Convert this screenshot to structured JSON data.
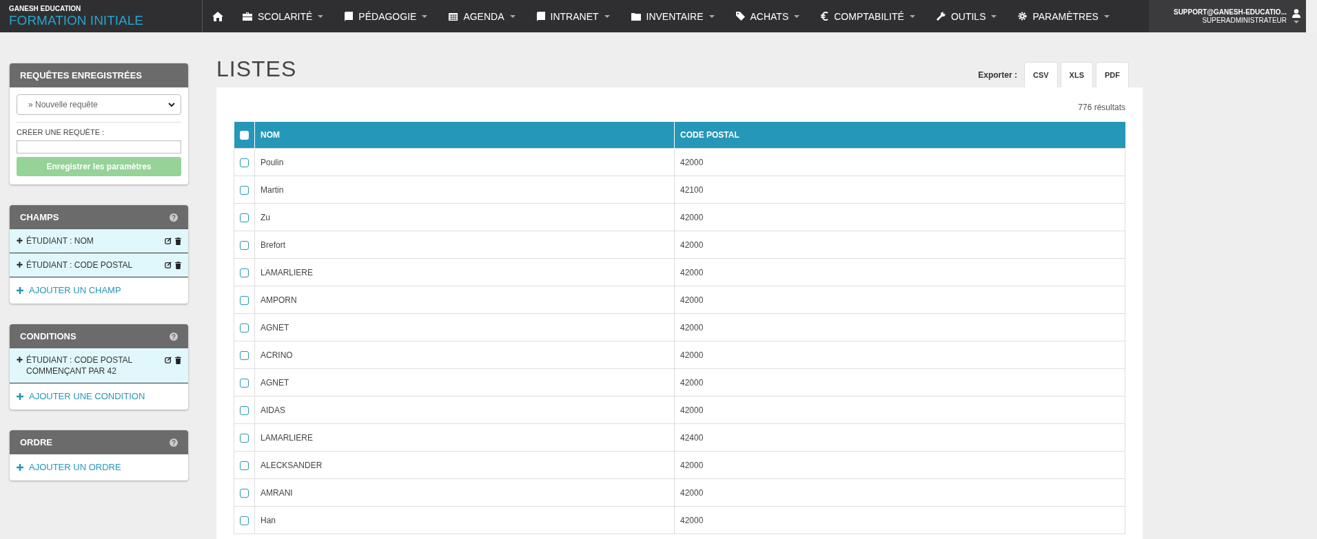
{
  "brand": {
    "org": "GANESH EDUCATION",
    "product": "FORMATION INITIALE"
  },
  "nav": [
    {
      "label": "SCOLARITÉ",
      "kind": "briefcase"
    },
    {
      "label": "PÉDAGOGIE",
      "kind": "book"
    },
    {
      "label": "AGENDA",
      "kind": "calendar"
    },
    {
      "label": "INTRANET",
      "kind": "book"
    },
    {
      "label": "INVENTAIRE",
      "kind": "folder"
    },
    {
      "label": "ACHATS",
      "kind": "tag"
    },
    {
      "label": "COMPTABILITÉ",
      "kind": "euro"
    },
    {
      "label": "OUTILS",
      "kind": "wrench"
    },
    {
      "label": "PARAMÈTRES",
      "kind": "gear"
    }
  ],
  "user": {
    "email": "SUPPORT@GANESH-EDUCATIO...",
    "role": "SUPERADMINISTRATEUR"
  },
  "sidebar": {
    "saved_queries": {
      "title": "REQUÊTES ENREGISTRÉES",
      "select_value": "» Nouvelle requête",
      "create_label": "CRÉER UNE REQUÊTE :",
      "save_button": "Enregistrer les paramètres",
      "save_disabled": true
    },
    "panels": [
      {
        "title": "CHAMPS",
        "items": [
          "ÉTUDIANT : NOM",
          "ÉTUDIANT : CODE POSTAL"
        ],
        "add": "AJOUTER UN CHAMP"
      },
      {
        "title": "CONDITIONS",
        "items": [
          "ÉTUDIANT : CODE POSTAL COMMENÇANT PAR 42"
        ],
        "add": "AJOUTER UNE CONDITION"
      },
      {
        "title": "ORDRE",
        "add": "AJOUTER UN ORDRE"
      }
    ]
  },
  "page_title": "LISTES",
  "export": {
    "label": "Exporter :",
    "buttons": [
      "CSV",
      "XLS",
      "PDF"
    ]
  },
  "result_count": "776 résultats",
  "table": {
    "select_all_checked": false,
    "columns": [
      "NOM",
      "CODE POSTAL"
    ],
    "rows": [
      {
        "nom": "Poulin",
        "code_postal": "42000",
        "checked": false
      },
      {
        "nom": "Martin",
        "code_postal": "42100",
        "checked": false
      },
      {
        "nom": "Zu",
        "code_postal": "42000",
        "checked": false
      },
      {
        "nom": "Brefort",
        "code_postal": "42000",
        "checked": false
      },
      {
        "nom": "LAMARLIERE",
        "code_postal": "42000",
        "checked": false
      },
      {
        "nom": "AMPORN",
        "code_postal": "42000",
        "checked": false
      },
      {
        "nom": "AGNET",
        "code_postal": "42000",
        "checked": false
      },
      {
        "nom": "ACRINO",
        "code_postal": "42000",
        "checked": false
      },
      {
        "nom": "AGNET",
        "code_postal": "42000",
        "checked": false
      },
      {
        "nom": "AIDAS",
        "code_postal": "42000",
        "checked": false
      },
      {
        "nom": "LAMARLIERE",
        "code_postal": "42400",
        "checked": false
      },
      {
        "nom": "ALECKSANDER",
        "code_postal": "42000",
        "checked": false
      },
      {
        "nom": "AMRANI",
        "code_postal": "42000",
        "checked": false
      },
      {
        "nom": "Han",
        "code_postal": "42000",
        "checked": false
      }
    ]
  }
}
